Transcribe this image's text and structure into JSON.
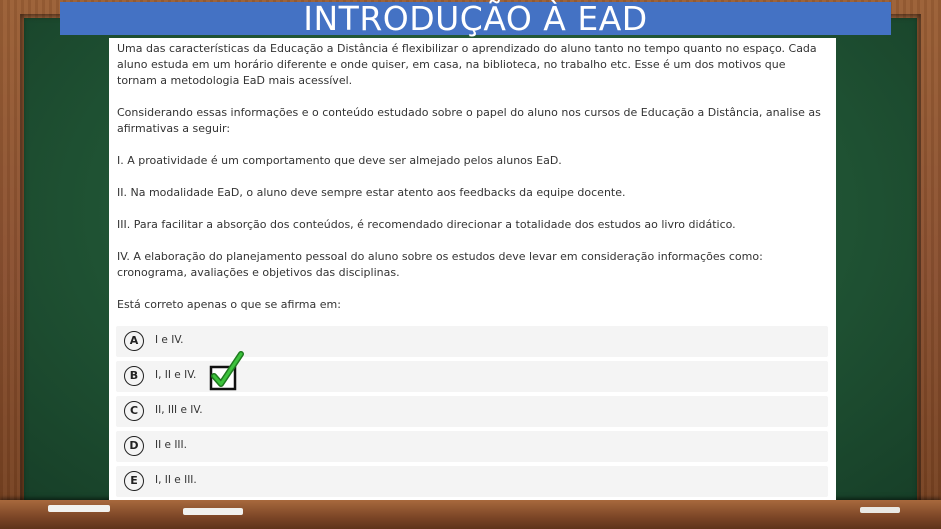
{
  "title": "INTRODUÇÃO À EAD",
  "question": {
    "intro": "Uma das características da Educação a Distância é flexibilizar o aprendizado do aluno tanto no tempo quanto no espaço. Cada aluno estuda em um horário diferente e onde quiser, em casa, na biblioteca, no trabalho etc. Esse é um dos motivos que tornam a metodologia EaD mais acessível.",
    "context": "Considerando essas informações e o conteúdo estudado sobre o papel do aluno nos cursos de Educação a Distância, analise as afirmativas a seguir:",
    "statements": [
      "I. A proatividade é um comportamento que deve ser almejado pelos alunos EaD.",
      "II. Na modalidade EaD, o aluno deve sempre estar atento aos feedbacks da equipe docente.",
      "III. Para facilitar a absorção dos conteúdos, é recomendado direcionar a totalidade dos estudos ao livro didático.",
      "IV. A elaboração do planejamento pessoal do aluno sobre os estudos deve levar em consideração informações como: cronograma, avaliações e objetivos das disciplinas."
    ],
    "prompt": "Está correto apenas o que se afirma em:"
  },
  "options": [
    {
      "letter": "A",
      "text": "I e IV."
    },
    {
      "letter": "B",
      "text": "I, II e IV."
    },
    {
      "letter": "C",
      "text": "II, III e IV."
    },
    {
      "letter": "D",
      "text": "II e III."
    },
    {
      "letter": "E",
      "text": "I, II e III."
    }
  ],
  "marked_option": "B",
  "colors": {
    "title_bar": "#4472c4",
    "check_mark": "#2a9d2a",
    "board": "#1f5233",
    "frame": "#8a5030"
  }
}
